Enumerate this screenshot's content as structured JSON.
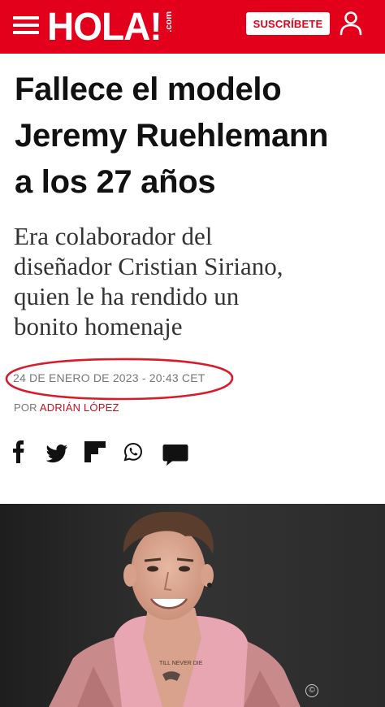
{
  "header": {
    "logo_text": "HOLA!",
    "logo_suffix": ".com",
    "subscribe_label": "SUSCRÍBETE",
    "menu_icon": "hamburger-menu-icon",
    "user_icon": "user-icon",
    "brand_color": "#e2001a"
  },
  "article": {
    "headline_line1": "Fallece el modelo",
    "headline_line2": "Jeremy Ruehlemann",
    "headline_line3": "a los 27 años",
    "subtitle_line1": "Era colaborador del",
    "subtitle_line2": "diseñador Cristian Siriano,",
    "subtitle_line3": "quien le ha rendido un",
    "subtitle_line4": "bonito homenaje",
    "date": "24 DE ENERO DE 2023 - 20:43 CET",
    "byline_prefix": "POR ",
    "author": "ADRIÁN LÓPEZ"
  },
  "share": {
    "icons": [
      "facebook-icon",
      "twitter-icon",
      "flipboard-icon",
      "whatsapp-icon",
      "comment-icon"
    ]
  },
  "image": {
    "copyright_symbol": "©"
  }
}
